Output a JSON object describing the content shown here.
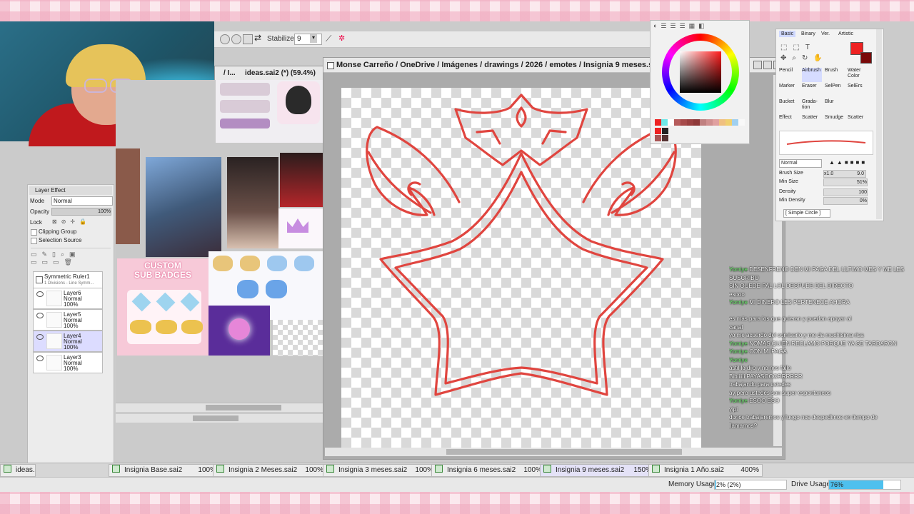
{
  "toolbar": {
    "stabilizer_label": "Stabilizer",
    "stabilizer_value": "9"
  },
  "ideas_window": {
    "title_prefix": "/ I...",
    "title": "ideas.sai2 (*) (59.4%)",
    "badge_title_line1": "CUSTOM",
    "badge_title_line2": "SUB BADGES"
  },
  "layer_panel": {
    "title": "Layer Effect",
    "mode_label": "Mode",
    "mode_value": "Normal",
    "opacity_label": "Opacity",
    "opacity_value": "100%",
    "lock_label": "Lock",
    "clipping_group": "Clipping Group",
    "selection_source": "Selection Source",
    "ruler": {
      "name": "Symmetric Ruler1",
      "sub": "1 Divisions - Line Symm..."
    },
    "layers": [
      {
        "name": "Layer6",
        "mode": "Normal",
        "opacity": "100%"
      },
      {
        "name": "Layer5",
        "mode": "Normal",
        "opacity": "100%"
      },
      {
        "name": "Layer4",
        "mode": "Normal",
        "opacity": "100%"
      },
      {
        "name": "Layer3",
        "mode": "Normal",
        "opacity": "100%"
      }
    ]
  },
  "main_window": {
    "title": "Monse Carreño / OneDrive / Imágenes / drawings / 2026 / emotes / Insignia 9 meses.sai2 (*)"
  },
  "brush_panel": {
    "tabs": [
      "Basic",
      "Binary",
      "Ver.",
      "Artistic"
    ],
    "tools": [
      [
        "Pencil",
        "Airbrush",
        "Brush",
        "Water Color"
      ],
      [
        "Marker",
        "Eraser",
        "SelPen",
        "SelErs"
      ],
      [
        "Bucket",
        "Grada-tion",
        "Blur",
        ""
      ],
      [
        "Effect",
        "Scatter",
        "Smudge",
        "Scatter"
      ]
    ],
    "blend_mode": "Normal",
    "brush_size_label": "Brush Size",
    "brush_size_mult": "x1.0",
    "brush_size_value": "9.0",
    "min_size_label": "Min Size",
    "min_size_value": "51%",
    "density_label": "Density",
    "density_value": "100",
    "min_density_label": "Min Density",
    "min_density_value": "0%",
    "shape": "[ Simple Circle ]"
  },
  "colors": {
    "primary": "#ee2222",
    "secondary": "#7a0a0a",
    "line": "#e0453f"
  },
  "chat": [
    {
      "user": "Yomiye",
      "text": "DESENFRENO DEN MI PAGA DEL ULTIMO MES Y ME LES"
    },
    {
      "user": "",
      "text": "SUSCRIBO"
    },
    {
      "user": "",
      "text": "SIN QUEDE PAL LOL DESPUES DEL DIRECTO"
    },
    {
      "user": "",
      "text": "esooo"
    },
    {
      "user": "Yomiye",
      "text": "MI DINERO LES PERTENECE AHORA"
    },
    {
      "user": "",
      "text": ""
    },
    {
      "user": "",
      "text": "es más para los que quieran y puedan apoyar al"
    },
    {
      "user": "",
      "text": "canal"
    },
    {
      "user": "",
      "text": "yo me acuerdo del comisario y me da muchisima risa"
    },
    {
      "user": "Yomiye",
      "text": "NOMAS QUIEN RECLAMO PORQUE YA SE TARDARON"
    },
    {
      "user": "Yomiye",
      "text": "CON MI PAGA"
    },
    {
      "user": "Yomiye",
      "text": ""
    },
    {
      "user": "",
      "text": "astil lo dijo y no nos fallo"
    },
    {
      "user": "",
      "text": "Bibiiiiii PAYASOOORRRRRR"
    },
    {
      "user": "",
      "text": "trabajando para ustedes"
    },
    {
      "user": "",
      "text": "ay pero ustedes son super espontaneos"
    },
    {
      "user": "Yomiye",
      "text": "ESOO ESO"
    },
    {
      "user": "",
      "text": "yipi"
    },
    {
      "user": "",
      "text": "donce trabajaremos y luego nos despedimos en tiempo de"
    },
    {
      "user": "",
      "text": "llamarnos?"
    }
  ],
  "tabs": [
    {
      "name": "ideas.",
      "zoom": ""
    },
    {
      "name": "Insignia Base.sai2",
      "zoom": "100%"
    },
    {
      "name": "Insignia 2 Meses.sai2",
      "zoom": "100%"
    },
    {
      "name": "Insignia 3 meses.sai2",
      "zoom": "100%"
    },
    {
      "name": "Insignia 6 meses.sai2",
      "zoom": "100%"
    },
    {
      "name": "Insignia 9 meses.sai2",
      "zoom": "150%"
    },
    {
      "name": "Insignia 1 Año.sai2",
      "zoom": "400%"
    }
  ],
  "status": {
    "memory_label": "Memory Usage",
    "memory_value": "2% (2%)",
    "memory_fraction": 0.02,
    "drive_label": "Drive Usage",
    "drive_value": "76%",
    "drive_fraction": 0.76
  }
}
